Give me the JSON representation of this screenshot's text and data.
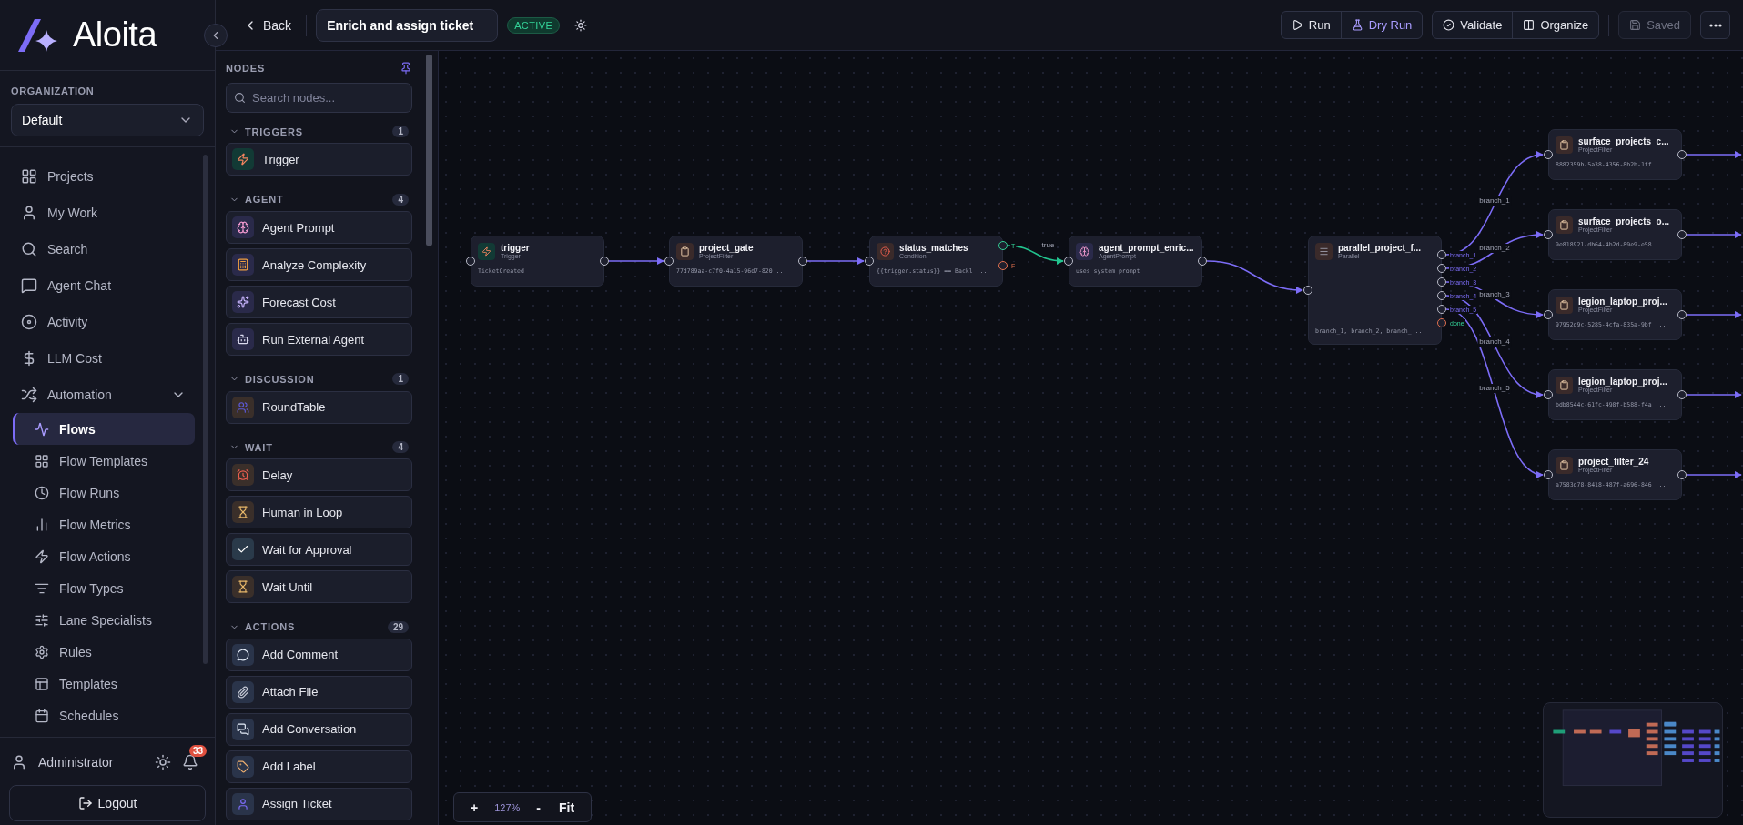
{
  "sidebar": {
    "brand": "Aloita",
    "org_label": "ORGANIZATION",
    "org": "Default",
    "nav": [
      {
        "label": "Projects",
        "selected": false
      },
      {
        "label": "My Work",
        "selected": false
      },
      {
        "label": "Search",
        "selected": false
      },
      {
        "label": "Agent Chat",
        "selected": false
      },
      {
        "label": "Activity",
        "selected": false
      },
      {
        "label": "LLM Cost",
        "selected": false
      },
      {
        "label": "Automation",
        "selected": false,
        "expanded": true,
        "children": [
          {
            "label": "Flows",
            "selected": true
          },
          {
            "label": "Flow Templates",
            "selected": false
          },
          {
            "label": "Flow Runs",
            "selected": false
          },
          {
            "label": "Flow Metrics",
            "selected": false
          },
          {
            "label": "Flow Actions",
            "selected": false
          },
          {
            "label": "Flow Types",
            "selected": false
          },
          {
            "label": "Lane Specialists",
            "selected": false
          },
          {
            "label": "Rules",
            "selected": false
          },
          {
            "label": "Templates",
            "selected": false
          },
          {
            "label": "Schedules",
            "selected": false
          }
        ]
      }
    ],
    "user": "Administrator",
    "notifications": "33",
    "logout": "Logout"
  },
  "toolbar": {
    "back": "Back",
    "flow_name": "Enrich and assign ticket",
    "status": "ACTIVE",
    "groups": [
      {
        "buttons": [
          {
            "label": "Run",
            "kind": "run"
          },
          {
            "label": "Dry Run",
            "kind": "dry"
          }
        ]
      },
      {
        "buttons": [
          {
            "label": "Validate",
            "kind": "validate"
          },
          {
            "label": "Organize",
            "kind": "organize"
          }
        ]
      }
    ],
    "saved": {
      "label": "Saved",
      "disabled": true
    }
  },
  "palette": {
    "title": "NODES",
    "search_placeholder": "Search nodes...",
    "groups": [
      {
        "name": "TRIGGERS",
        "count": "1",
        "expanded": true,
        "items": [
          "Trigger"
        ]
      },
      {
        "name": "AGENT",
        "count": "4",
        "expanded": true,
        "items": [
          "Agent Prompt",
          "Analyze Complexity",
          "Forecast Cost",
          "Run External Agent"
        ]
      },
      {
        "name": "DISCUSSION",
        "count": "1",
        "expanded": true,
        "items": [
          "RoundTable"
        ]
      },
      {
        "name": "WAIT",
        "count": "4",
        "expanded": true,
        "items": [
          "Delay",
          "Human in Loop",
          "Wait for Approval",
          "Wait Until"
        ]
      },
      {
        "name": "ACTIONS",
        "count": "29",
        "expanded": true,
        "items": [
          "Add Comment",
          "Attach File",
          "Add Conversation",
          "Add Label",
          "Assign Ticket"
        ]
      }
    ]
  },
  "canvas": {
    "nodes": [
      {
        "kind": "trigger",
        "title": "trigger",
        "type": "Trigger",
        "detail": "TicketCreated"
      },
      {
        "kind": "filter",
        "title": "project_gate",
        "type": "ProjectFilter",
        "detail": "77d789aa-c7f0-4a15-96d7-820 ..."
      },
      {
        "kind": "condition",
        "title": "status_matches",
        "type": "Condition",
        "detail": "{{trigger.status}} == Backl ...",
        "ports": [
          {
            "label": "T",
            "kind": "true"
          },
          {
            "label": "F",
            "kind": "false"
          }
        ]
      },
      {
        "kind": "agent",
        "title": "agent_prompt_enric...",
        "type": "AgentPrompt",
        "detail": "uses system prompt"
      },
      {
        "kind": "parallel",
        "title": "parallel_project_f...",
        "type": "Parallel",
        "detail": "branch_1, branch_2, branch_ ...",
        "ports": [
          {
            "label": "branch_1",
            "kind": "branch"
          },
          {
            "label": "branch_2",
            "kind": "branch"
          },
          {
            "label": "branch_3",
            "kind": "branch"
          },
          {
            "label": "branch_4",
            "kind": "branch"
          },
          {
            "label": "branch_5",
            "kind": "branch"
          },
          {
            "label": "done",
            "kind": "done"
          }
        ]
      },
      {
        "kind": "filter",
        "title": "surface_projects_c...",
        "type": "ProjectFilter",
        "detail": "8882359b-5a38-4356-8b2b-1ff ..."
      },
      {
        "kind": "filter",
        "title": "surface_projects_o...",
        "type": "ProjectFilter",
        "detail": "9e818921-db64-4b2d-89e9-e58 ..."
      },
      {
        "kind": "filter",
        "title": "legion_laptop_proj...",
        "type": "ProjectFilter",
        "detail": "97952d9c-5285-4cfa-835a-9bf ..."
      },
      {
        "kind": "filter",
        "title": "legion_laptop_proj...",
        "type": "ProjectFilter",
        "detail": "bdb8544c-61fc-498f-b588-f4a ..."
      },
      {
        "kind": "filter",
        "title": "project_filter_24",
        "type": "ProjectFilter",
        "detail": "a7583d78-8418-487f-a696-846 ..."
      }
    ],
    "edge_labels": [
      "true",
      "branch_1",
      "branch_2",
      "branch_3",
      "branch_4",
      "branch_5"
    ],
    "zoom_in": "+",
    "zoom": "127%",
    "zoom_out": "-",
    "fit": "Fit"
  }
}
